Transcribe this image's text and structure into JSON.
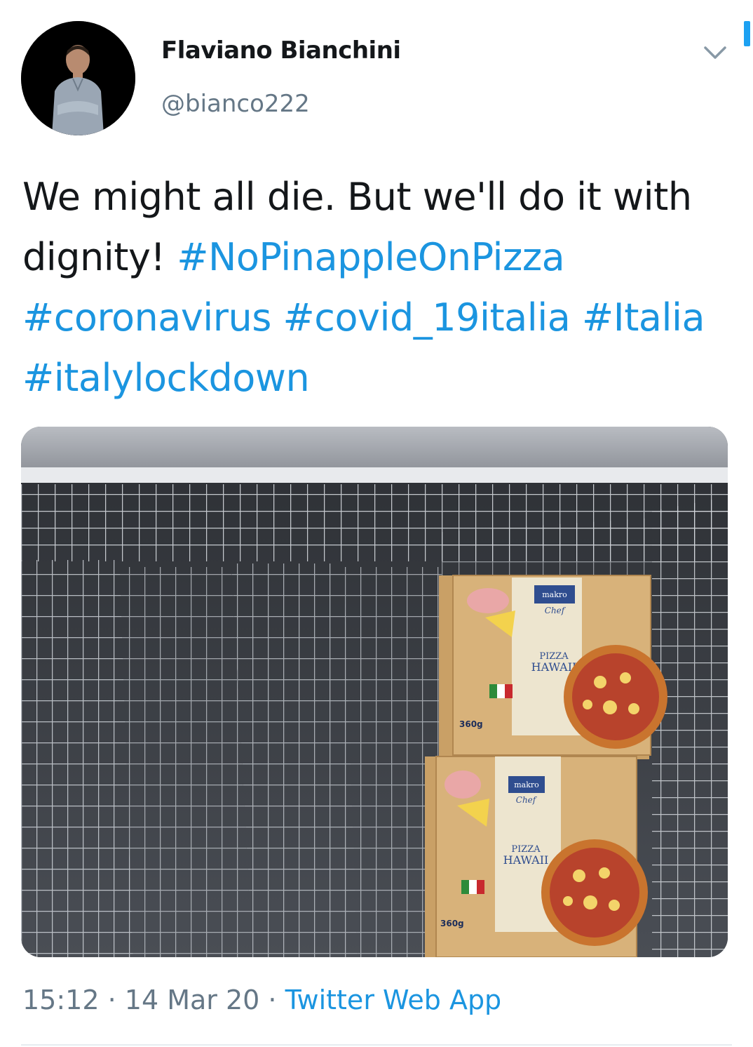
{
  "author": {
    "display_name": "Flaviano Bianchini",
    "handle": "@bianco222"
  },
  "tweet": {
    "line1": "We might all die. But we'll do it with",
    "line2_text": "dignity!",
    "hashtags": [
      "#NoPinappleOnPizza",
      "#coronavirus",
      "#covid_19italia",
      "#Italia",
      "#italylockdown"
    ]
  },
  "media": {
    "boxes": [
      {
        "brand": "makro",
        "sub": "Chef",
        "title1": "PIZZA",
        "title2": "HAWAII",
        "weight": "360g"
      },
      {
        "brand": "makro",
        "sub": "Chef",
        "title1": "PIZZA",
        "title2": "HAWAII",
        "weight": "360g"
      }
    ]
  },
  "meta": {
    "time": "15:12",
    "separator": " · ",
    "date": "14 Mar 20",
    "source": "Twitter Web App"
  },
  "colors": {
    "link": "#1b95e0",
    "secondary_text": "#657786",
    "primary_text": "#14171a"
  },
  "icons": [
    "chevron-down-icon"
  ]
}
